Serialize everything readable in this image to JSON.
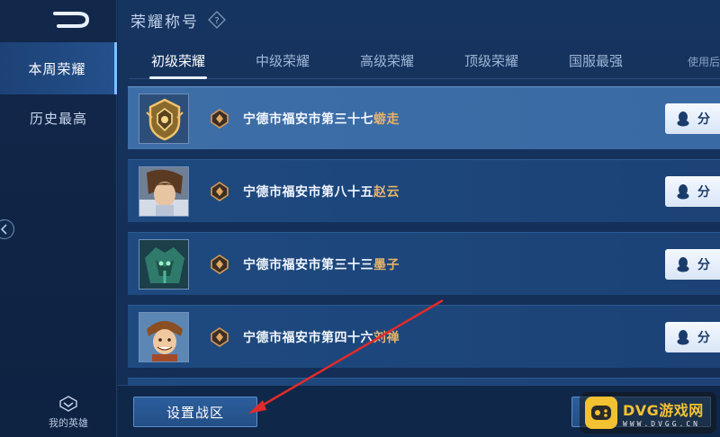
{
  "sidebar": {
    "items": [
      {
        "label": "本周荣耀",
        "active": true
      },
      {
        "label": "历史最高",
        "active": false
      }
    ],
    "my_heroes_label": "我的英雄"
  },
  "header": {
    "title": "荣耀称号"
  },
  "tabs": [
    {
      "label": "初级荣耀",
      "active": true
    },
    {
      "label": "中级荣耀",
      "active": false
    },
    {
      "label": "高级荣耀",
      "active": false
    },
    {
      "label": "顶级荣耀",
      "active": false
    },
    {
      "label": "国服最强",
      "active": false
    }
  ],
  "usage_note": "使用后",
  "rows": [
    {
      "title_prefix": "宁德市福安市第三十七",
      "hero": "蝣走",
      "highlight": true,
      "share_label": "分"
    },
    {
      "title_prefix": "宁德市福安市第八十五",
      "hero": "赵云",
      "highlight": false,
      "share_label": "分"
    },
    {
      "title_prefix": "宁德市福安市第三十三",
      "hero": "墨子",
      "highlight": false,
      "share_label": "分"
    },
    {
      "title_prefix": "宁德市福安市第四十六",
      "hero": "刘禅",
      "highlight": false,
      "share_label": "分"
    }
  ],
  "footer": {
    "set_zone_label": "设置战区"
  },
  "watermark": {
    "brand": "DVG游戏网",
    "url": "WWW.DVGG.CN"
  },
  "colors": {
    "hero_name": "#e6b36a",
    "annotation_arrow": "#e02b2b"
  }
}
